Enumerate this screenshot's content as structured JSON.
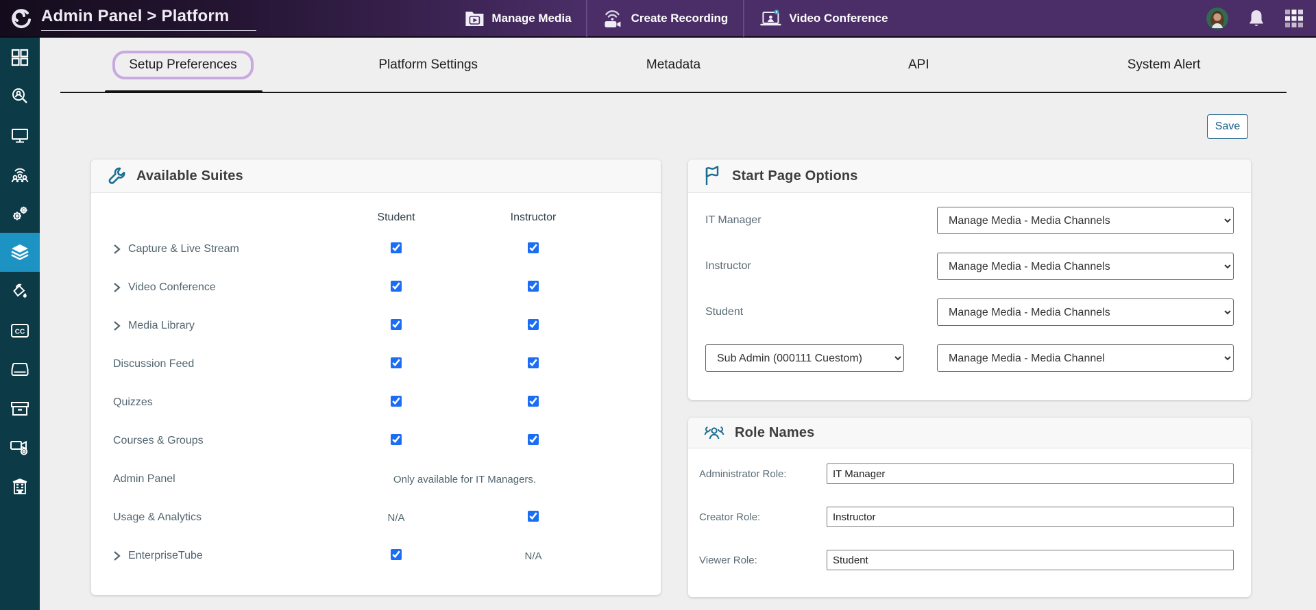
{
  "header": {
    "title": "Admin Panel > Platform",
    "actions": [
      {
        "label": "Manage Media",
        "icon": "media-folder-icon"
      },
      {
        "label": "Create Recording",
        "icon": "recording-camera-icon"
      },
      {
        "label": "Video Conference",
        "icon": "video-conference-icon"
      }
    ]
  },
  "sidebar": {
    "items": [
      "dashboard",
      "user-search",
      "desktop",
      "webcast-audience",
      "services-gears",
      "modules-layers",
      "branding-paint",
      "captions",
      "storage-drive",
      "archive-box",
      "recording-settings",
      "institution-building"
    ],
    "active_index": 5
  },
  "tabs": {
    "items": [
      "Setup Preferences",
      "Platform Settings",
      "Metadata",
      "API",
      "System Alert"
    ],
    "active": "Setup Preferences"
  },
  "save_label": "Save",
  "available_suites": {
    "title": "Available Suites",
    "columns": [
      "Student",
      "Instructor"
    ],
    "rows": [
      {
        "label": "Capture & Live Stream",
        "expandable": true,
        "student_checked": true,
        "instructor_checked": true
      },
      {
        "label": "Video Conference",
        "expandable": true,
        "student_checked": true,
        "instructor_checked": true
      },
      {
        "label": "Media Library",
        "expandable": true,
        "student_checked": true,
        "instructor_checked": true
      },
      {
        "label": "Discussion Feed",
        "expandable": false,
        "student_checked": true,
        "instructor_checked": true
      },
      {
        "label": "Quizzes",
        "expandable": false,
        "student_checked": true,
        "instructor_checked": true
      },
      {
        "label": "Courses & Groups",
        "expandable": false,
        "student_checked": true,
        "instructor_checked": true
      },
      {
        "label": "Admin Panel",
        "expandable": false,
        "note": "Only available for IT Managers."
      },
      {
        "label": "Usage & Analytics",
        "expandable": false,
        "student_text": "N/A",
        "instructor_checked": true
      },
      {
        "label": "EnterpriseTube",
        "expandable": true,
        "student_checked": true,
        "instructor_text": "N/A"
      }
    ]
  },
  "start_page_options": {
    "title": "Start Page Options",
    "rows": [
      {
        "label": "IT Manager",
        "value": "Manage Media - Media Channels"
      },
      {
        "label": "Instructor",
        "value": "Manage Media - Media Channels"
      },
      {
        "label": "Student",
        "value": "Manage Media - Media Channels"
      }
    ],
    "sub_admin": {
      "role": "Sub Admin (000111 Cuestom)",
      "value": "Manage Media - Media Channel"
    }
  },
  "role_names": {
    "title": "Role Names",
    "fields": [
      {
        "label": "Administrator Role:",
        "value": "IT Manager"
      },
      {
        "label": "Creator Role:",
        "value": "Instructor"
      },
      {
        "label": "Viewer Role:",
        "value": "Student"
      }
    ]
  },
  "colors": {
    "topbar_purple": "#4b2e68",
    "topbar_dark": "#140c1c",
    "sidebar_teal": "#0d3a47",
    "sidebar_active_blue": "#1d93c4",
    "highlight_ring_purple": "#c9a9e0",
    "card_icon_teal": "#1b6d90",
    "checkbox_blue": "#1b6ef3",
    "save_border_blue": "#145d85"
  }
}
